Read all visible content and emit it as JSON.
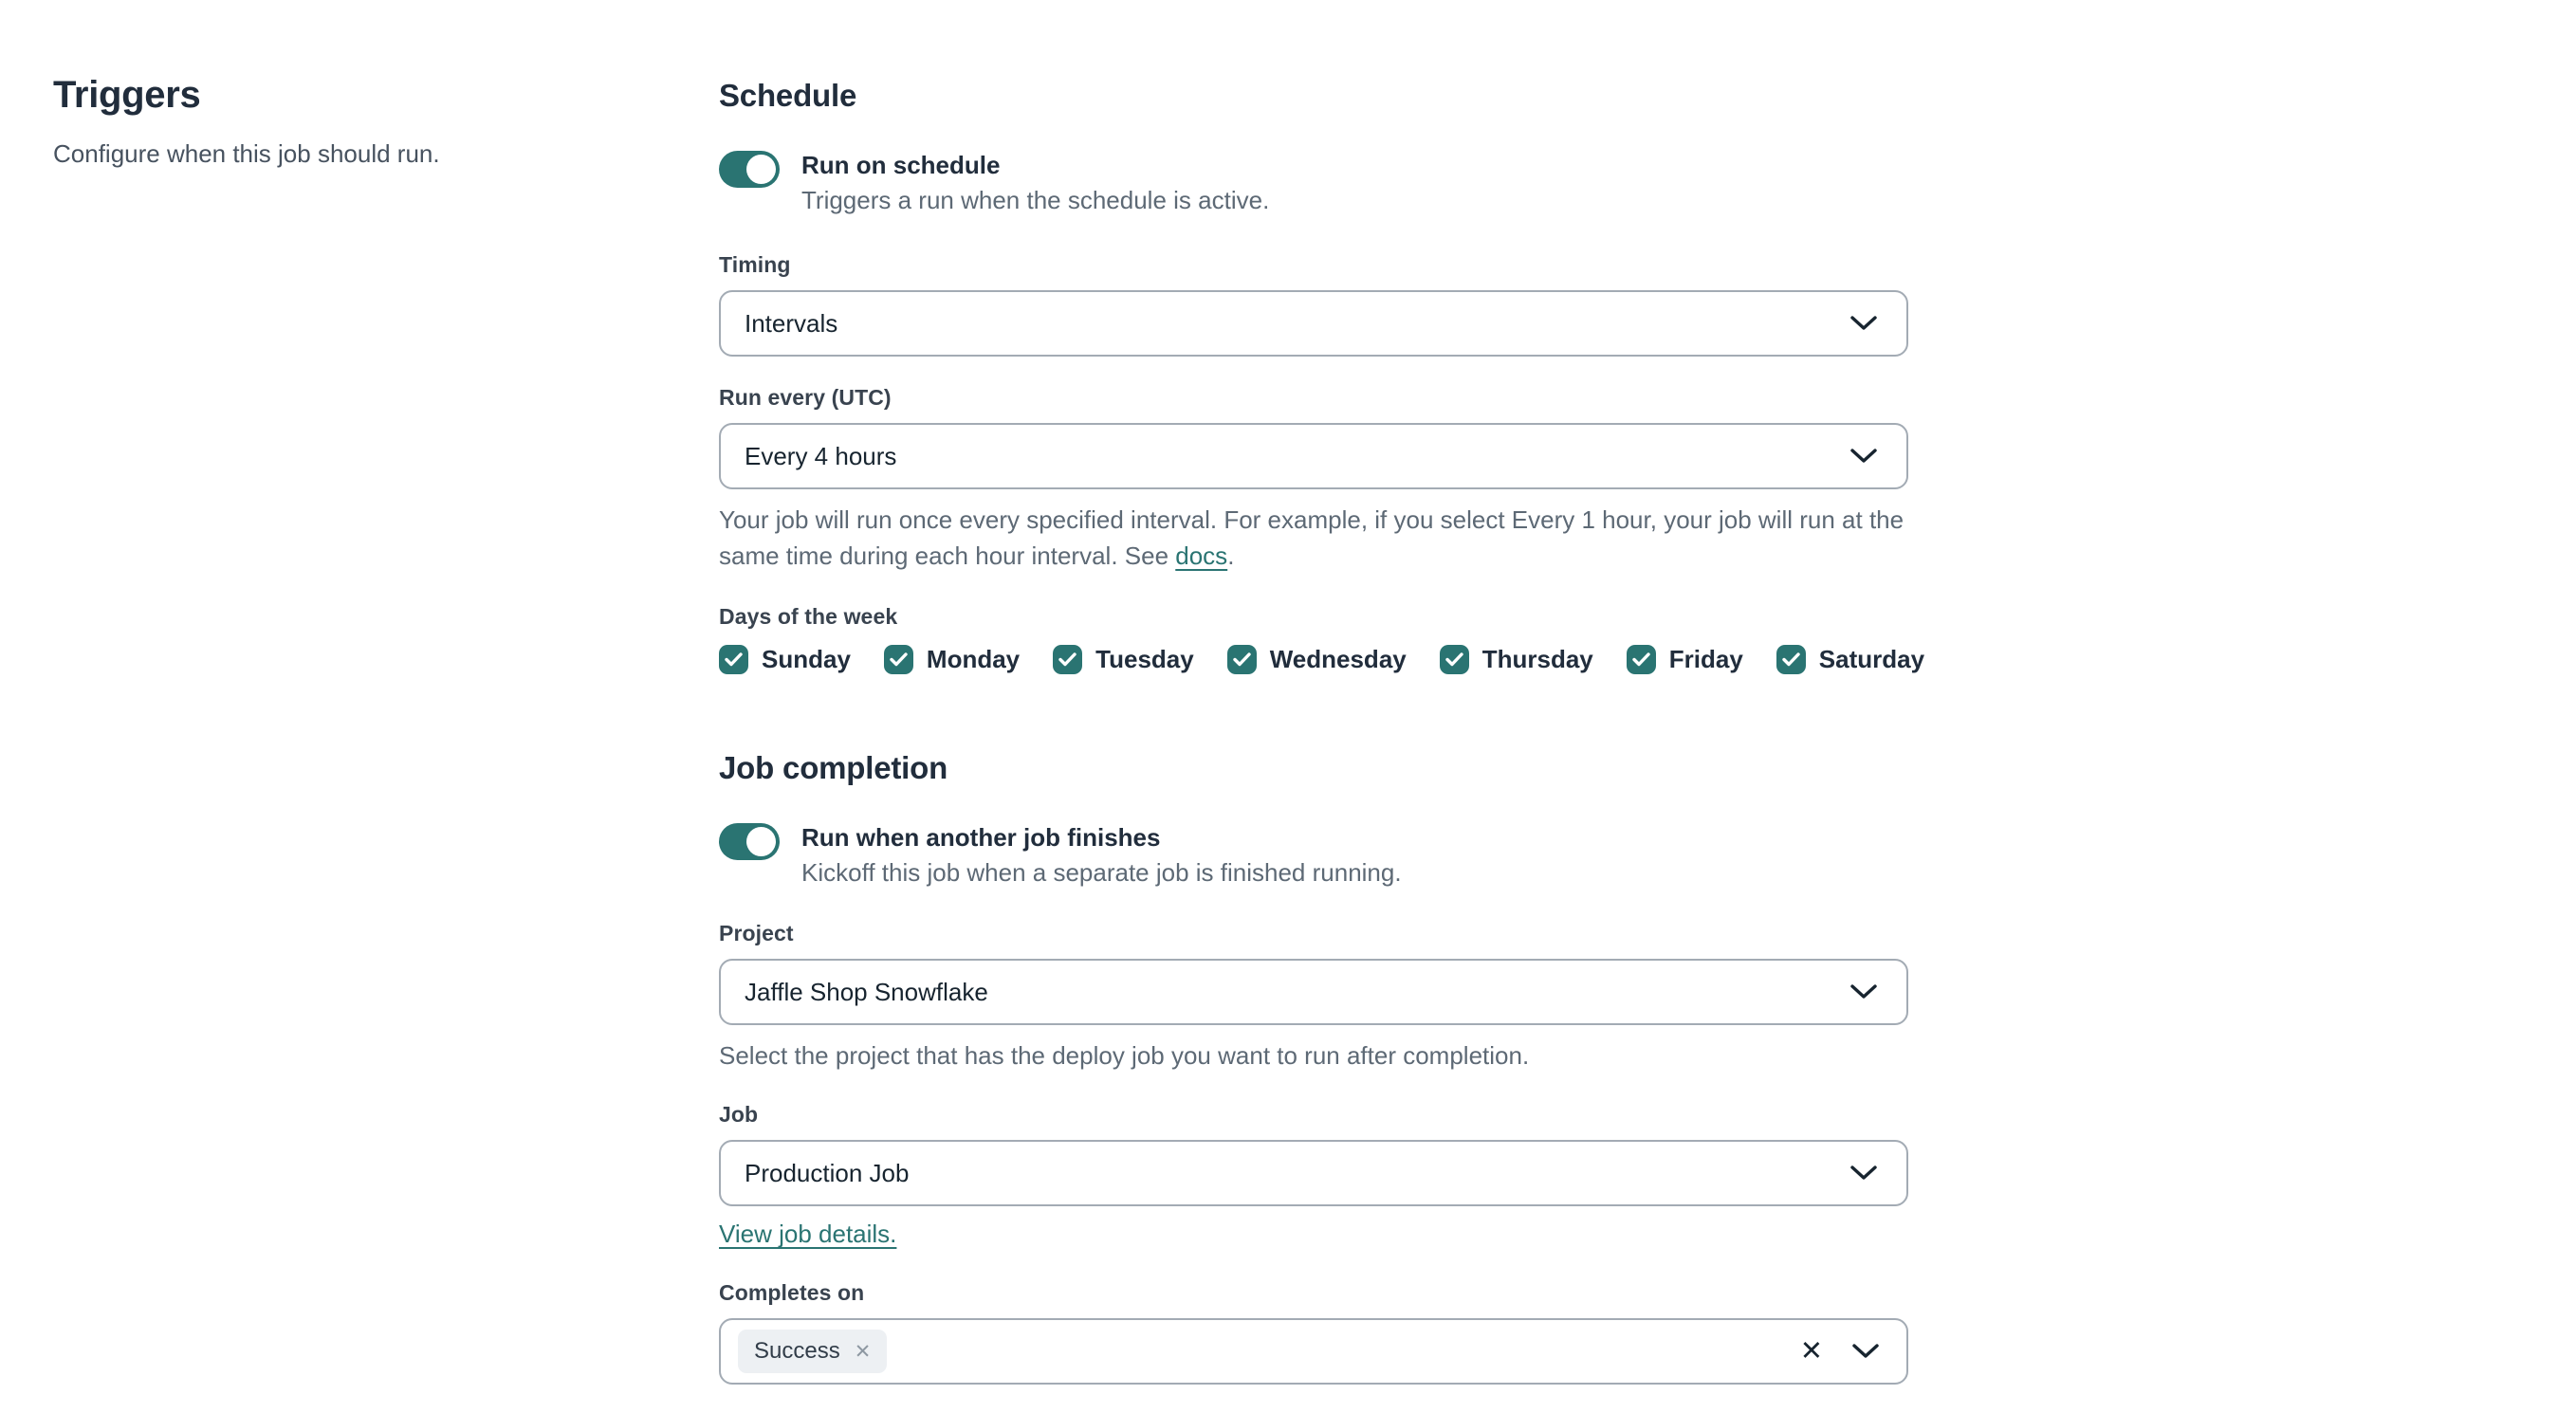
{
  "colors": {
    "accent": "#2a7472",
    "heading": "#212d3c",
    "text": "#2b3645",
    "muted": "#5d6975",
    "border": "#a3abb4",
    "tag_bg": "#edf0f3"
  },
  "left": {
    "title": "Triggers",
    "subtitle": "Configure when this job should run."
  },
  "schedule": {
    "heading": "Schedule",
    "run_on_schedule": {
      "label": "Run on schedule",
      "description": "Triggers a run when the schedule is active.",
      "state": "on"
    },
    "timing": {
      "label": "Timing",
      "value": "Intervals"
    },
    "run_every": {
      "label": "Run every (UTC)",
      "value": "Every 4 hours",
      "help_prefix": "Your job will run once every specified interval. For example, if you select Every 1 hour, your job will run at the same time during each hour interval. See ",
      "help_link_label": "docs",
      "help_suffix": "."
    },
    "days": {
      "label": "Days of the week",
      "items": [
        {
          "label": "Sunday",
          "checked": true
        },
        {
          "label": "Monday",
          "checked": true
        },
        {
          "label": "Tuesday",
          "checked": true
        },
        {
          "label": "Wednesday",
          "checked": true
        },
        {
          "label": "Thursday",
          "checked": true
        },
        {
          "label": "Friday",
          "checked": true
        },
        {
          "label": "Saturday",
          "checked": true
        }
      ]
    }
  },
  "job_completion": {
    "heading": "Job completion",
    "run_when": {
      "label": "Run when another job finishes",
      "description": "Kickoff this job when a separate job is finished running.",
      "state": "on"
    },
    "project": {
      "label": "Project",
      "value": "Jaffle Shop Snowflake",
      "help": "Select the project that has the deploy job you want to run after completion."
    },
    "job": {
      "label": "Job",
      "value": "Production Job",
      "details_link": "View job details."
    },
    "completes_on": {
      "label": "Completes on",
      "tags": [
        "Success"
      ],
      "remove_tag_glyph": "✕",
      "clear_glyph": "✕"
    }
  }
}
